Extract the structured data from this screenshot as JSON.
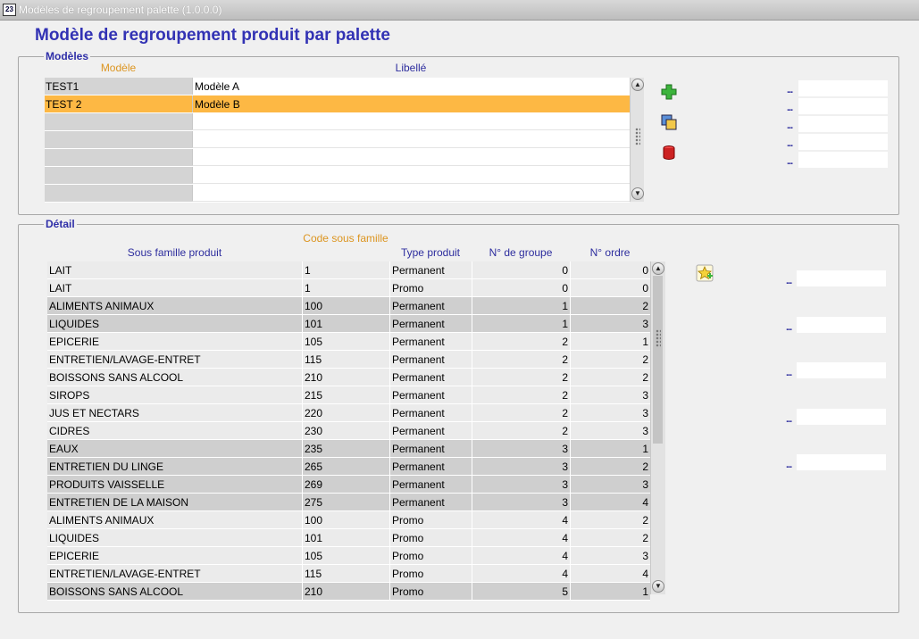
{
  "window": {
    "title": "Modèles de regroupement palette (1.0.0.0)"
  },
  "page_title": "Modèle de regroupement produit par palette",
  "models": {
    "legend": "Modèles",
    "col_model": "Modèle",
    "col_label": "Libellé",
    "rows": [
      {
        "model": "TEST1",
        "label": "Modèle A",
        "selected": false
      },
      {
        "model": "TEST 2",
        "label": "Modèle B",
        "selected": true
      }
    ],
    "side_dots": [
      "...",
      "...",
      "...",
      "...",
      "..."
    ]
  },
  "detail": {
    "legend": "Détail",
    "col_subfamily": "Sous famille produit",
    "col_code": "Code sous famille",
    "col_type": "Type produit",
    "col_group": "N° de groupe",
    "col_order": "N° ordre",
    "rows": [
      {
        "subfamily": "LAIT",
        "code": "1",
        "type": "Permanent",
        "group": "0",
        "order": "0",
        "shade": "light"
      },
      {
        "subfamily": "LAIT",
        "code": "1",
        "type": "Promo",
        "group": "0",
        "order": "0",
        "shade": "light"
      },
      {
        "subfamily": "ALIMENTS ANIMAUX",
        "code": "100",
        "type": "Permanent",
        "group": "1",
        "order": "2",
        "shade": "dark"
      },
      {
        "subfamily": "LIQUIDES",
        "code": "101",
        "type": "Permanent",
        "group": "1",
        "order": "3",
        "shade": "dark"
      },
      {
        "subfamily": "EPICERIE",
        "code": "105",
        "type": "Permanent",
        "group": "2",
        "order": "1",
        "shade": "light"
      },
      {
        "subfamily": "ENTRETIEN/LAVAGE-ENTRET",
        "code": "115",
        "type": "Permanent",
        "group": "2",
        "order": "2",
        "shade": "light"
      },
      {
        "subfamily": "BOISSONS SANS ALCOOL",
        "code": "210",
        "type": "Permanent",
        "group": "2",
        "order": "2",
        "shade": "light"
      },
      {
        "subfamily": "SIROPS",
        "code": "215",
        "type": "Permanent",
        "group": "2",
        "order": "3",
        "shade": "light"
      },
      {
        "subfamily": "JUS ET NECTARS",
        "code": "220",
        "type": "Permanent",
        "group": "2",
        "order": "3",
        "shade": "light"
      },
      {
        "subfamily": "CIDRES",
        "code": "230",
        "type": "Permanent",
        "group": "2",
        "order": "3",
        "shade": "light"
      },
      {
        "subfamily": "EAUX",
        "code": "235",
        "type": "Permanent",
        "group": "3",
        "order": "1",
        "shade": "dark"
      },
      {
        "subfamily": "ENTRETIEN DU LINGE",
        "code": "265",
        "type": "Permanent",
        "group": "3",
        "order": "2",
        "shade": "dark"
      },
      {
        "subfamily": "PRODUITS VAISSELLE",
        "code": "269",
        "type": "Permanent",
        "group": "3",
        "order": "3",
        "shade": "dark"
      },
      {
        "subfamily": "ENTRETIEN DE LA MAISON",
        "code": "275",
        "type": "Permanent",
        "group": "3",
        "order": "4",
        "shade": "dark"
      },
      {
        "subfamily": "ALIMENTS ANIMAUX",
        "code": "100",
        "type": "Promo",
        "group": "4",
        "order": "2",
        "shade": "light"
      },
      {
        "subfamily": "LIQUIDES",
        "code": "101",
        "type": "Promo",
        "group": "4",
        "order": "2",
        "shade": "light"
      },
      {
        "subfamily": "EPICERIE",
        "code": "105",
        "type": "Promo",
        "group": "4",
        "order": "3",
        "shade": "light"
      },
      {
        "subfamily": "ENTRETIEN/LAVAGE-ENTRET",
        "code": "115",
        "type": "Promo",
        "group": "4",
        "order": "4",
        "shade": "light"
      },
      {
        "subfamily": "BOISSONS SANS ALCOOL",
        "code": "210",
        "type": "Promo",
        "group": "5",
        "order": "1",
        "shade": "dark"
      }
    ],
    "side_dots": [
      "...",
      "...",
      "...",
      "...",
      "..."
    ]
  },
  "colors": {
    "title": "#3232b4",
    "header_orange": "#dc9520",
    "header_blue": "#2d2d9e",
    "selection": "#fdb844"
  }
}
